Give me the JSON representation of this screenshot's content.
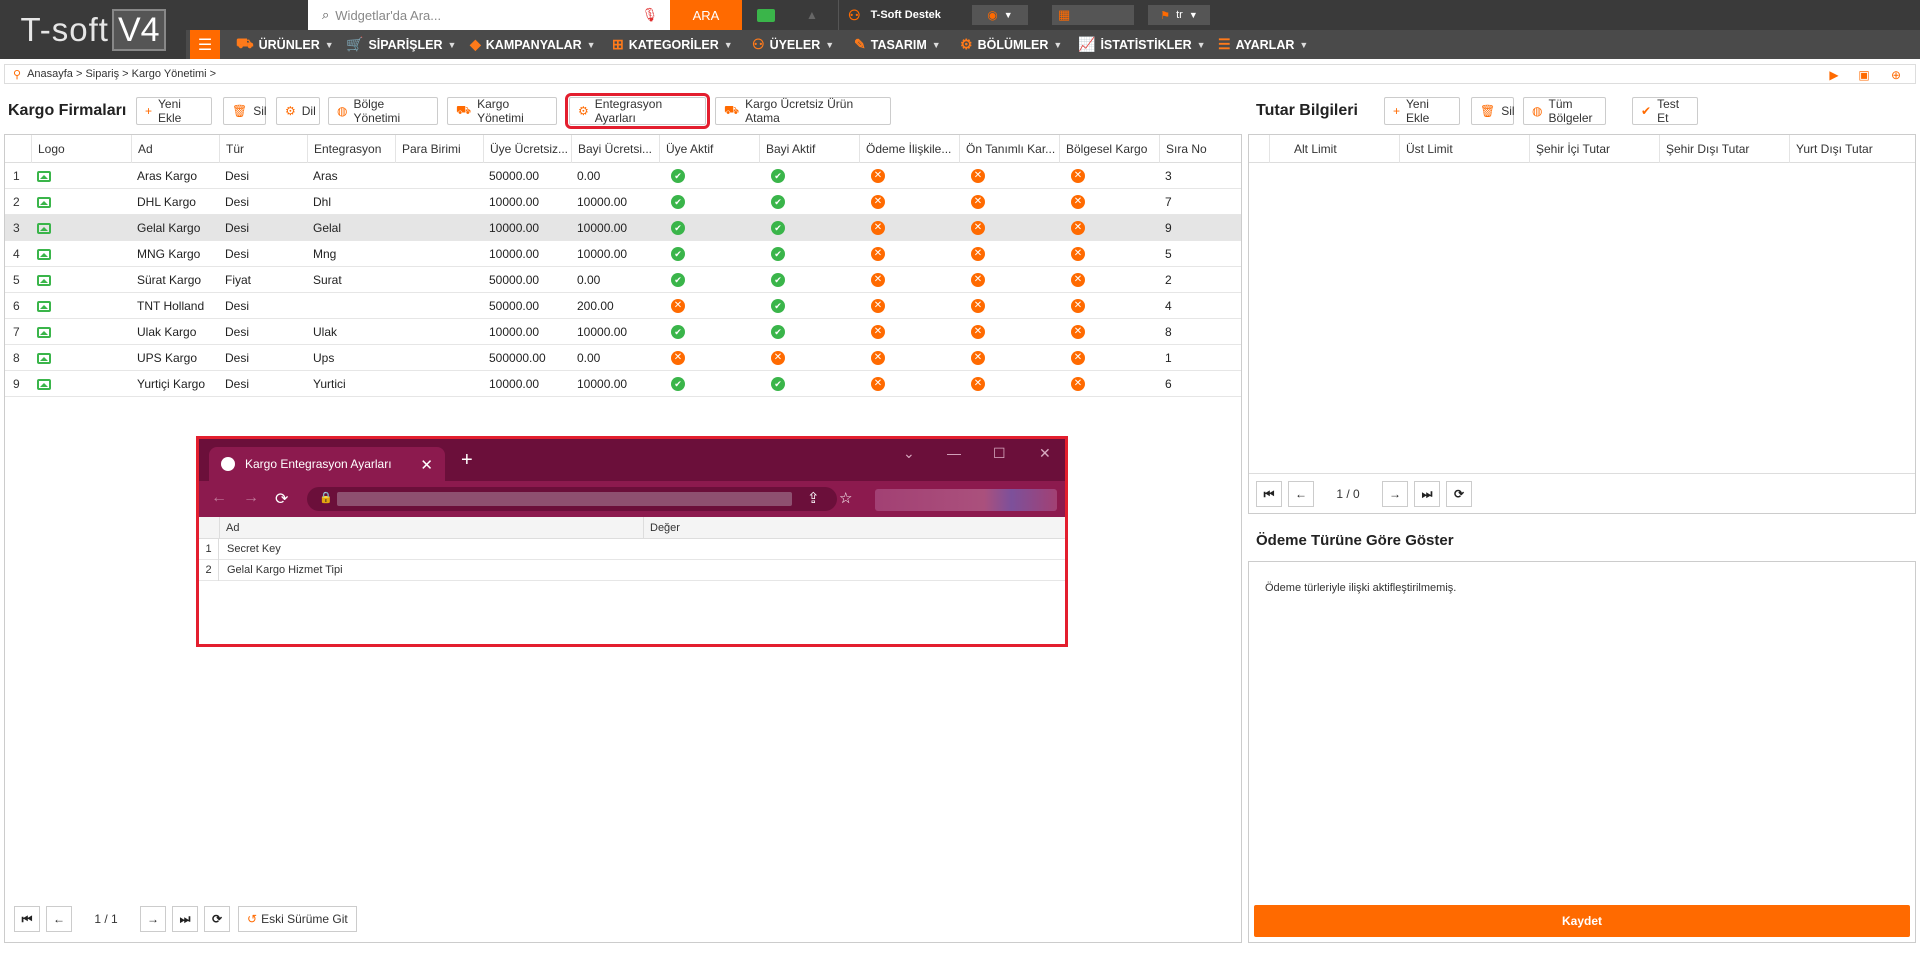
{
  "topbar": {
    "logo_text": "T-soft",
    "logo_version": "V4",
    "search_placeholder": "Widgetlar'da Ara...",
    "search_button": "ARA",
    "support_label": "T-Soft Destek",
    "language": "tr"
  },
  "nav": {
    "items": [
      "ÜRÜNLER",
      "SİPARİŞLER",
      "KAMPANYALAR",
      "KATEGORİLER",
      "ÜYELER",
      "TASARIM",
      "BÖLÜMLER",
      "İSTATİSTİKLER",
      "AYARLAR"
    ]
  },
  "breadcrumb": "Anasayfa > Sipariş > Kargo Yönetimi >",
  "left": {
    "title": "Kargo Firmaları",
    "buttons": [
      "Yeni Ekle",
      "Sil",
      "Dil",
      "Bölge Yönetimi",
      "Kargo Yönetimi",
      "Entegrasyon Ayarları",
      "Kargo Ücretsiz Ürün Atama"
    ],
    "columns": [
      "Logo",
      "Ad",
      "Tür",
      "Entegrasyon",
      "Para Birimi",
      "Üye Ücretsiz...",
      "Bayi Ücretsi...",
      "Üye Aktif",
      "Bayi Aktif",
      "Ödeme İlişkile...",
      "Ön Tanımlı Kar...",
      "Bölgesel Kargo",
      "Sıra No"
    ],
    "rows": [
      {
        "n": "1",
        "ad": "Aras Kargo",
        "tur": "Desi",
        "ent": "Aras",
        "uye_ucr": "50000.00",
        "bayi_ucr": "0.00",
        "uye_aktif": true,
        "bayi_aktif": true,
        "odeme": false,
        "ontan": false,
        "bolgesel": false,
        "sira": "3"
      },
      {
        "n": "2",
        "ad": "DHL Kargo",
        "tur": "Desi",
        "ent": "Dhl",
        "uye_ucr": "10000.00",
        "bayi_ucr": "10000.00",
        "uye_aktif": true,
        "bayi_aktif": true,
        "odeme": false,
        "ontan": false,
        "bolgesel": false,
        "sira": "7"
      },
      {
        "n": "3",
        "ad": "Gelal Kargo",
        "tur": "Desi",
        "ent": "Gelal",
        "uye_ucr": "10000.00",
        "bayi_ucr": "10000.00",
        "uye_aktif": true,
        "bayi_aktif": true,
        "odeme": false,
        "ontan": false,
        "bolgesel": false,
        "sira": "9"
      },
      {
        "n": "4",
        "ad": "MNG Kargo",
        "tur": "Desi",
        "ent": "Mng",
        "uye_ucr": "10000.00",
        "bayi_ucr": "10000.00",
        "uye_aktif": true,
        "bayi_aktif": true,
        "odeme": false,
        "ontan": false,
        "bolgesel": false,
        "sira": "5"
      },
      {
        "n": "5",
        "ad": "Sürat Kargo",
        "tur": "Fiyat",
        "ent": "Surat",
        "uye_ucr": "50000.00",
        "bayi_ucr": "0.00",
        "uye_aktif": true,
        "bayi_aktif": true,
        "odeme": false,
        "ontan": false,
        "bolgesel": false,
        "sira": "2"
      },
      {
        "n": "6",
        "ad": "TNT Holland",
        "tur": "Desi",
        "ent": "",
        "uye_ucr": "50000.00",
        "bayi_ucr": "200.00",
        "uye_aktif": false,
        "bayi_aktif": true,
        "odeme": false,
        "ontan": false,
        "bolgesel": false,
        "sira": "4"
      },
      {
        "n": "7",
        "ad": "Ulak Kargo",
        "tur": "Desi",
        "ent": "Ulak",
        "uye_ucr": "10000.00",
        "bayi_ucr": "10000.00",
        "uye_aktif": true,
        "bayi_aktif": true,
        "odeme": false,
        "ontan": false,
        "bolgesel": false,
        "sira": "8"
      },
      {
        "n": "8",
        "ad": "UPS Kargo",
        "tur": "Desi",
        "ent": "Ups",
        "uye_ucr": "500000.00",
        "bayi_ucr": "0.00",
        "uye_aktif": false,
        "bayi_aktif": false,
        "odeme": false,
        "ontan": false,
        "bolgesel": false,
        "sira": "1"
      },
      {
        "n": "9",
        "ad": "Yurtiçi Kargo",
        "tur": "Desi",
        "ent": "Yurtici",
        "uye_ucr": "10000.00",
        "bayi_ucr": "10000.00",
        "uye_aktif": true,
        "bayi_aktif": true,
        "odeme": false,
        "ontan": false,
        "bolgesel": false,
        "sira": "6"
      }
    ],
    "selected_row": 3,
    "pager_info": "1 / 1",
    "old_version_label": "Eski Sürüme Git"
  },
  "popup": {
    "tab_title": "Kargo Entegrasyon Ayarları",
    "columns": [
      "Ad",
      "Değer"
    ],
    "rows": [
      {
        "n": "1",
        "ad": "Secret Key"
      },
      {
        "n": "2",
        "ad": "Gelal Kargo Hizmet Tipi"
      }
    ]
  },
  "right": {
    "title": "Tutar Bilgileri",
    "buttons": [
      "Yeni Ekle",
      "Sil",
      "Tüm Bölgeler",
      "Test Et"
    ],
    "columns": [
      "Alt Limit",
      "Üst Limit",
      "Şehir İçi Tutar",
      "Şehir Dışı Tutar",
      "Yurt Dışı Tutar"
    ],
    "pager_info": "1 / 0",
    "payment_title": "Ödeme Türüne Göre Göster",
    "payment_text": "Ödeme türleriyle ilişki aktifleştirilmemiş.",
    "save_label": "Kaydet"
  },
  "colors": {
    "accent": "#ff6a00",
    "ok": "#3ab54a",
    "highlight": "#e31e2e",
    "popup_frame": "#6b0f3a"
  }
}
